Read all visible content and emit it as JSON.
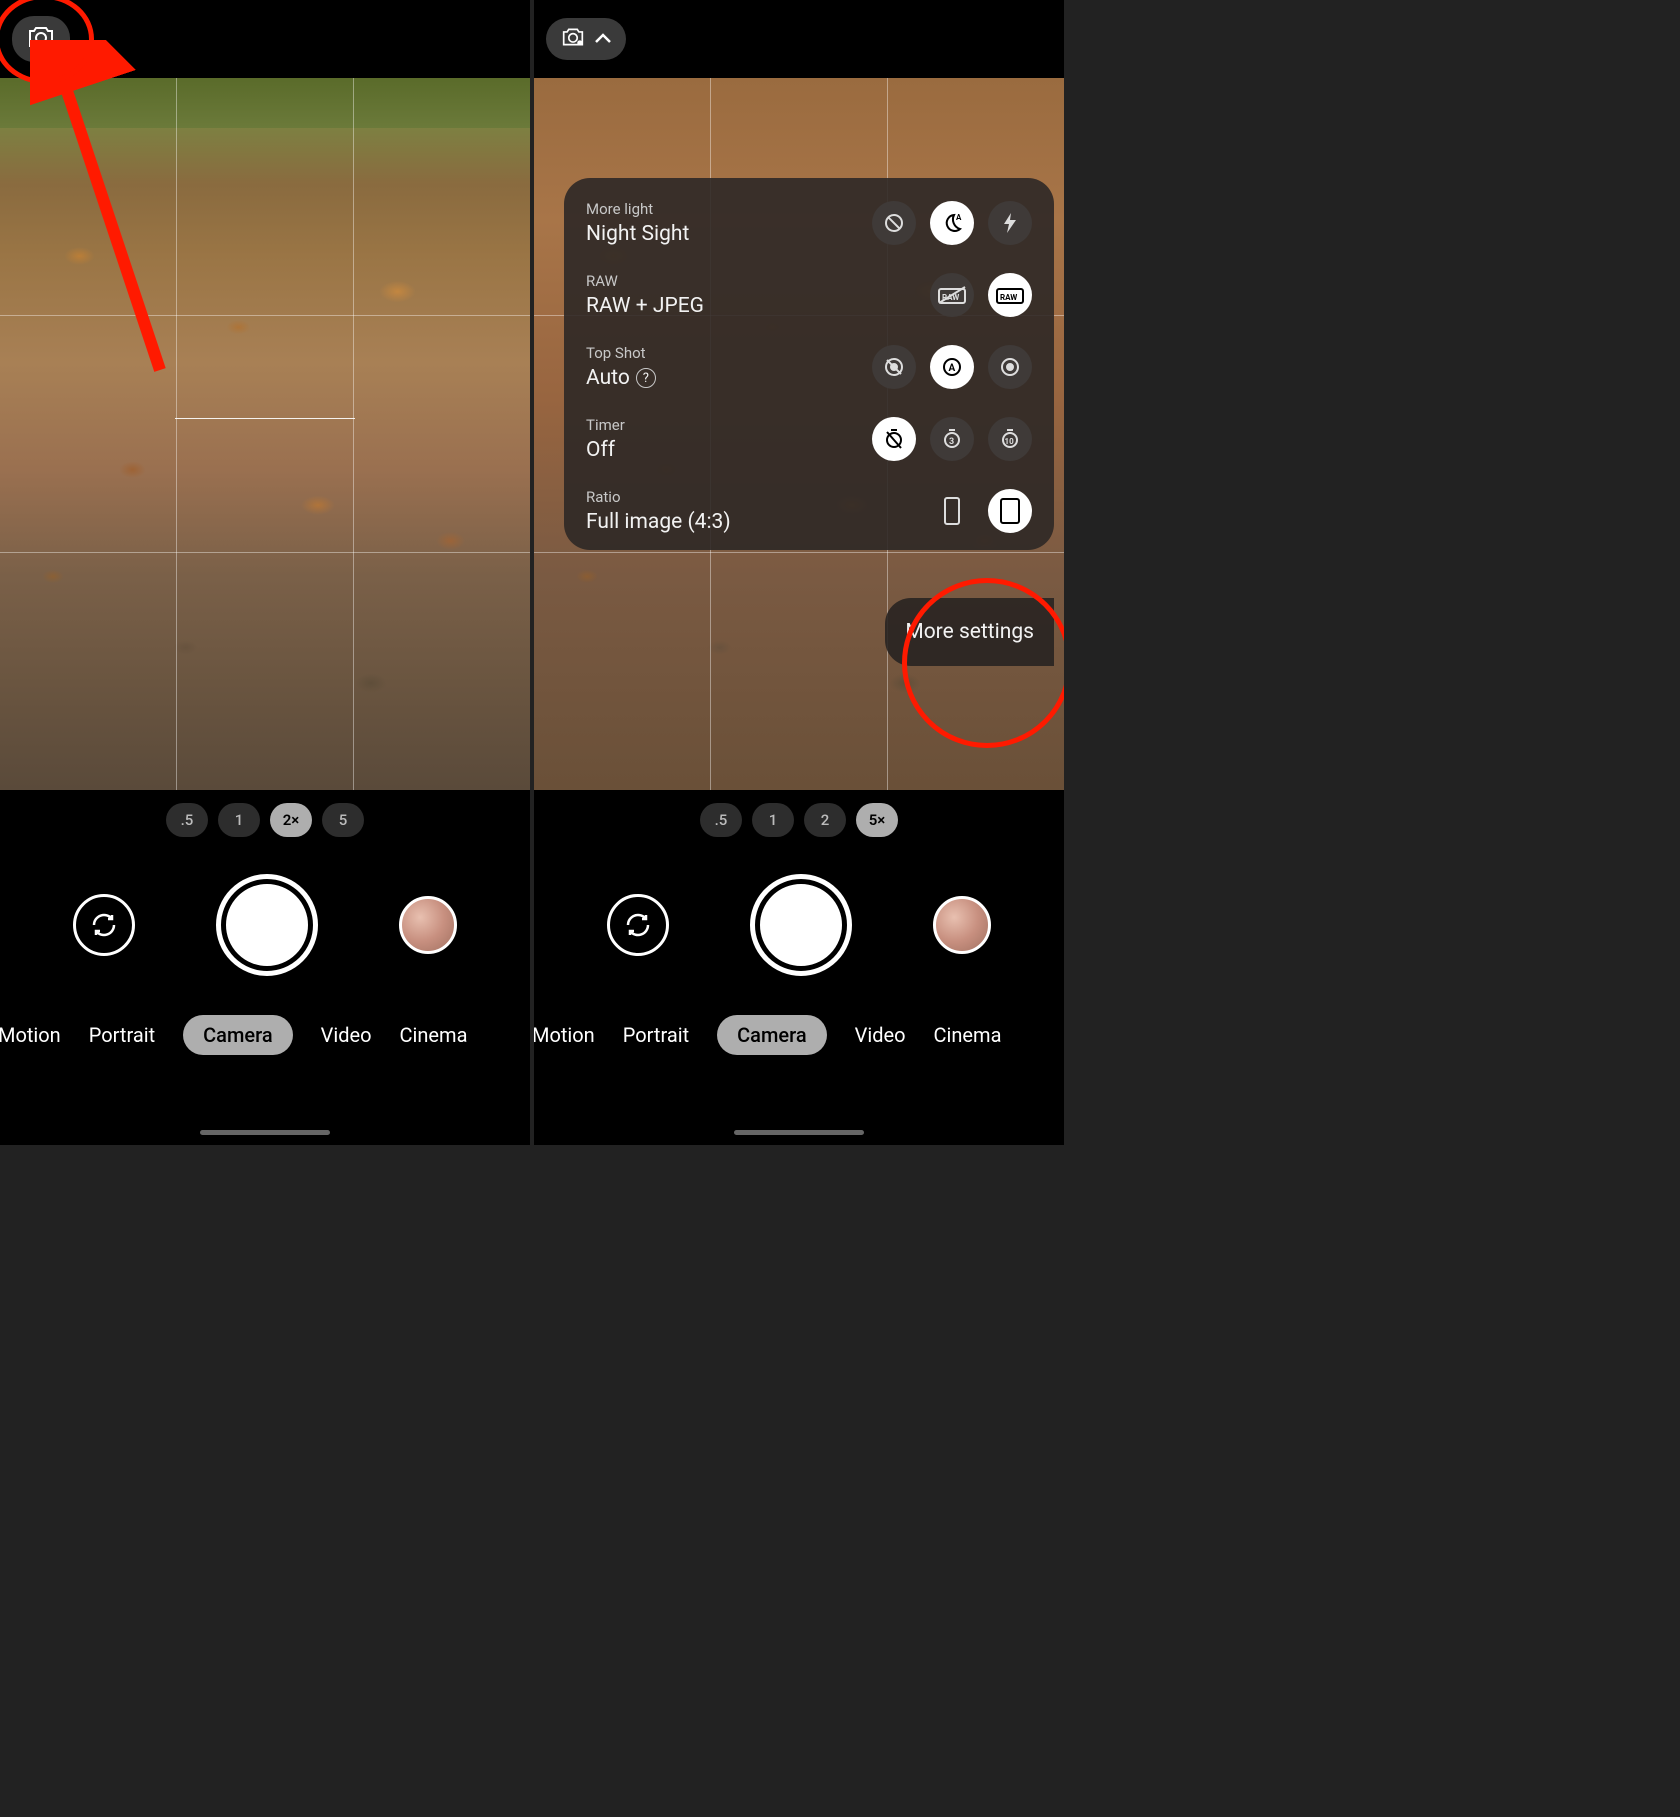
{
  "left": {
    "zoom": {
      "options": [
        ".5",
        "1",
        "2×",
        "5"
      ],
      "selected": 2
    },
    "modes": {
      "items": [
        "Motion",
        "Portrait",
        "Camera",
        "Video",
        "Cinema"
      ],
      "selected": 2
    }
  },
  "right": {
    "zoom": {
      "options": [
        ".5",
        "1",
        "2",
        "5×"
      ],
      "selected": 3
    },
    "modes": {
      "items": [
        "Motion",
        "Portrait",
        "Camera",
        "Video",
        "Cinema"
      ],
      "selected": 2
    },
    "panel": {
      "more_light": {
        "title": "More light",
        "value": "Night Sight",
        "options": [
          "off",
          "auto",
          "flash"
        ],
        "selected": 1
      },
      "raw": {
        "title": "RAW",
        "value": "RAW + JPEG",
        "options": [
          "raw-off",
          "raw-on"
        ],
        "selected": 1
      },
      "topshot": {
        "title": "Top Shot",
        "value": "Auto",
        "help": "?",
        "options": [
          "off",
          "auto",
          "on"
        ],
        "selected": 1
      },
      "timer": {
        "title": "Timer",
        "value": "Off",
        "options": [
          "off",
          "3",
          "10"
        ],
        "selected": 0
      },
      "ratio": {
        "title": "Ratio",
        "value": "Full image (4:3)",
        "options": [
          "wide",
          "full"
        ],
        "selected": 1
      }
    },
    "more_settings_label": "More settings"
  }
}
